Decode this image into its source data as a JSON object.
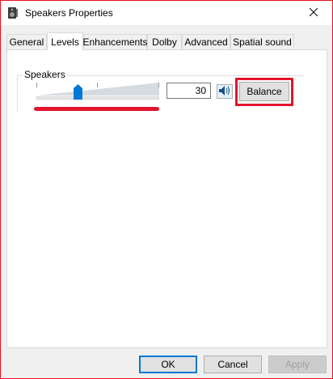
{
  "window": {
    "title": "Speakers Properties",
    "close_icon": "close-icon"
  },
  "tabs": [
    {
      "label": "General",
      "active": false
    },
    {
      "label": "Levels",
      "active": true
    },
    {
      "label": "Enhancements",
      "active": false
    },
    {
      "label": "Dolby",
      "active": false
    },
    {
      "label": "Advanced",
      "active": false
    },
    {
      "label": "Spatial sound",
      "active": false
    }
  ],
  "levels": {
    "group_label": "Speakers",
    "volume_value": "30",
    "volume_level": 0.3,
    "mute_icon": "speaker-icon",
    "balance_label": "Balance"
  },
  "footer": {
    "ok_label": "OK",
    "cancel_label": "Cancel",
    "apply_label": "Apply"
  },
  "colors": {
    "accent": "#0078d7",
    "highlight": "#e3142d"
  }
}
